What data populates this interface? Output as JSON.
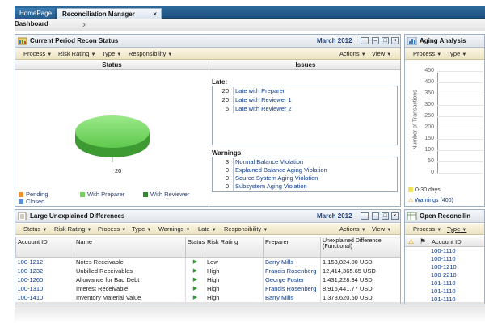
{
  "tabs": {
    "home": "HomePage",
    "recon": "Reconciliation Manager",
    "close": "×"
  },
  "breadcrumb": {
    "label": "Dashboard",
    "chevron": "›"
  },
  "recon_panel": {
    "title": "Current Period Recon Status",
    "period": "March 2012",
    "menus": [
      "Process",
      "Risk Rating",
      "Type",
      "Responsibility"
    ],
    "right_menus": [
      "Actions",
      "View"
    ],
    "status_header": "Status",
    "issues_header": "Issues",
    "pie_label": "20",
    "late_label": "Late:",
    "late_items": [
      {
        "count": "20",
        "text": "Late with Preparer"
      },
      {
        "count": "20",
        "text": "Late with Reviewer 1"
      },
      {
        "count": "5",
        "text": "Late with Reviewer 2"
      }
    ],
    "warnings_label": "Warnings:",
    "warning_items": [
      {
        "count": "3",
        "text": "Normal Balance Violation"
      },
      {
        "count": "0",
        "text": "Explained Balance Aging Violation"
      },
      {
        "count": "0",
        "text": "Source System Aging Violation"
      },
      {
        "count": "0",
        "text": "Subsystem Aging Violation"
      }
    ],
    "legend": [
      {
        "label": "Pending",
        "color": "#e8903a"
      },
      {
        "label": "With Preparer",
        "color": "#6fd35a"
      },
      {
        "label": "With Reviewer",
        "color": "#2e8b2e"
      },
      {
        "label": "Closed",
        "color": "#5b8fd4"
      }
    ]
  },
  "aging_panel": {
    "title": "Aging Analysis",
    "menus": [
      "Process",
      "Type"
    ],
    "y_ticks": [
      "450",
      "400",
      "350",
      "300",
      "250",
      "200",
      "150",
      "100",
      "50",
      "0"
    ],
    "y_label": "Number of Transactions",
    "legend_days": "0-30 days",
    "legend_color": "#f2e25a",
    "warnings_link": "Warnings (400)"
  },
  "diff_panel": {
    "title": "Large Unexplained Differences",
    "period": "March 2012",
    "menus": [
      "Status",
      "Risk Rating",
      "Process",
      "Type",
      "Warnings",
      "Late",
      "Responsibility"
    ],
    "right_menus": [
      "Actions",
      "View"
    ],
    "columns": [
      "Account ID",
      "Name",
      "Status",
      "Risk Rating",
      "Preparer",
      "Unexplained Difference (Functional)"
    ],
    "rows": [
      {
        "id": "100-1212",
        "name": "Notes Receivable",
        "risk": "Low",
        "preparer": "Barry Mills",
        "diff": "1,153,824.00 USD"
      },
      {
        "id": "100-1232",
        "name": "Unbilled Receivables",
        "risk": "High",
        "preparer": "Francis Rosenberg",
        "diff": "12,414,365.65 USD"
      },
      {
        "id": "100-1260",
        "name": "Allowance for Bad Debt",
        "risk": "High",
        "preparer": "George Foster",
        "diff": "1,431,228.34 USD"
      },
      {
        "id": "100-1310",
        "name": "Interest Receivable",
        "risk": "High",
        "preparer": "Francis Rosenberg",
        "diff": "8,915,441.77 USD"
      },
      {
        "id": "100-1410",
        "name": "Inventory Material Value",
        "risk": "High",
        "preparer": "Barry Mills",
        "diff": "1,378,620.50 USD"
      }
    ]
  },
  "open_panel": {
    "title": "Open Reconcilin",
    "menus": [
      "Process",
      "Type"
    ],
    "col_account": "Account ID",
    "rows": [
      "100-1110",
      "100-1110",
      "100-1210",
      "100-2210",
      "101-1110",
      "101-1110",
      "101-1110"
    ]
  },
  "colors": {
    "accent": "#1d4f7c",
    "link": "#0b3b8f",
    "pie": "#6fd35a"
  }
}
